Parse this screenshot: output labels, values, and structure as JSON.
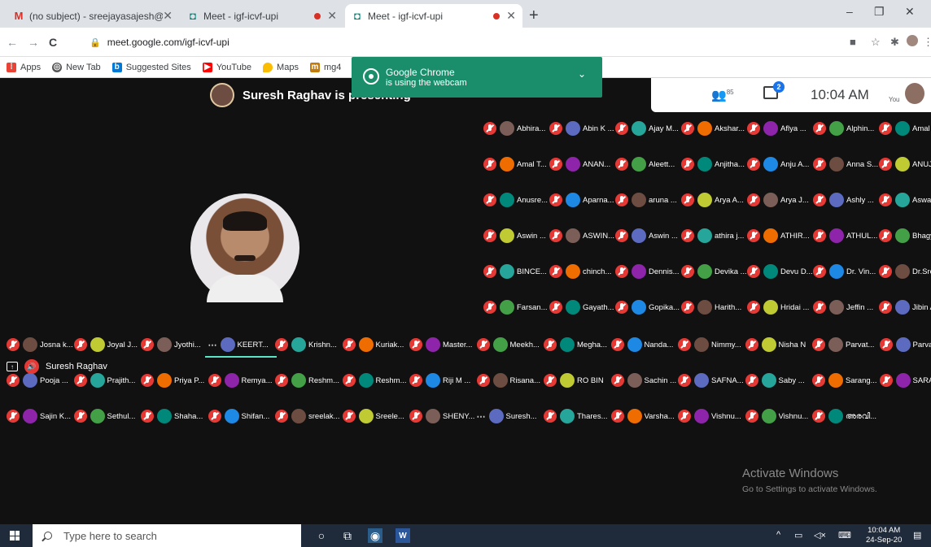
{
  "browser": {
    "tabs": [
      {
        "title": "(no subject) - sreejayasajesh@gr",
        "favicon": "gmail-icon"
      },
      {
        "title": "Meet - igf-icvf-upi",
        "favicon": "meet-icon"
      },
      {
        "title": "Meet - igf-icvf-upi",
        "favicon": "meet-icon"
      }
    ],
    "url": "meet.google.com/igf-icvf-upi",
    "bookmarks": [
      "Apps",
      "New Tab",
      "Suggested Sites",
      "YouTube",
      "Maps",
      "mg4"
    ]
  },
  "popup": {
    "line1": "Google Chrome",
    "line2": "is using the webcam"
  },
  "meet": {
    "presenting": "Suresh Raghav is presenting",
    "participant_count": "85",
    "chat_badge": "2",
    "clock": "10:04 AM",
    "you_label": "You",
    "presenter_name": "Suresh Raghav"
  },
  "participants": [
    [
      "Abhira...",
      "Abin K ...",
      "Ajay M...",
      "Akshar...",
      "Aflya ...",
      "Alphin...",
      "Amal R"
    ],
    [
      "Amal T...",
      "ANAN...",
      "Aleett...",
      "Anjitha...",
      "Anju A...",
      "Anna S...",
      "ANUJ"
    ],
    [
      "Anusre...",
      "Aparna...",
      "aruna ...",
      "Arya A...",
      "Arya J...",
      "Ashly ...",
      "Aswat"
    ],
    [
      "Aswin ...",
      "ASWIN...",
      "Aswin ...",
      "athira j...",
      "ATHIR...",
      "ATHUL...",
      "Bhagy"
    ],
    [
      "BINCE...",
      "chinch...",
      "Dennis...",
      "Devika ...",
      "Devu D...",
      "Dr. Vin...",
      "Dr.Sree"
    ],
    [
      "Farsan...",
      "Gayath...",
      "Gopika...",
      "Harith...",
      "Hridai ...",
      "Jeffin ...",
      "Jibin A"
    ],
    [
      "Josna k...",
      "Joyal J...",
      "Jyothi...",
      "KEERT...",
      "Krishn...",
      "Kuriak...",
      "Master...",
      "Meekh...",
      "Megha...",
      "Nanda...",
      "Nimmy...",
      "Nisha N",
      "Parvat...",
      "Parvat"
    ],
    [
      "Pooja ...",
      "Prajith...",
      "Priya P...",
      "Remya...",
      "Reshm...",
      "Reshm...",
      "Riji M ...",
      "Risana...",
      "RO BIN",
      "Sachin ...",
      "SAFNA...",
      "Saby ...",
      "Sarang...",
      "SARAN"
    ],
    [
      "Sajin K...",
      "Sethul...",
      "Shaha...",
      "Shifan...",
      "sreelak...",
      "Sreele...",
      "SHENY...",
      "Suresh...",
      "Thares...",
      "Varsha...",
      "Vishnu...",
      "Vishnu...",
      "അരവി..."
    ]
  ],
  "watermark": {
    "title": "Activate Windows",
    "sub": "Go to Settings to activate Windows."
  },
  "taskbar": {
    "search_placeholder": "Type here to search",
    "time": "10:04 AM",
    "date": "24-Sep-20"
  }
}
